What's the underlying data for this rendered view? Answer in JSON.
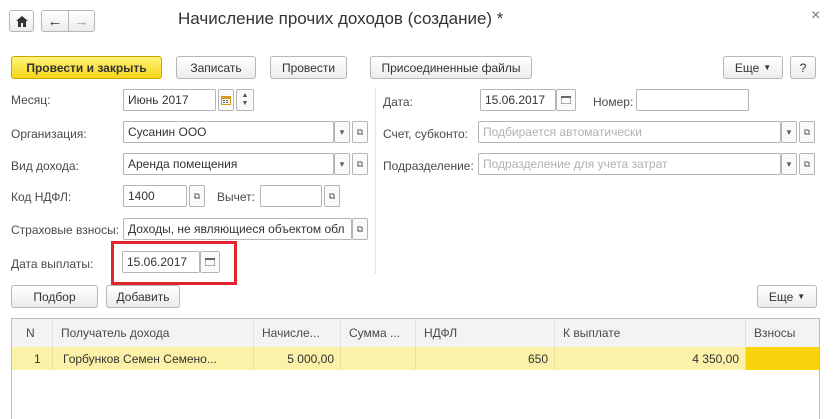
{
  "window": {
    "title": "Начисление прочих доходов (создание) *",
    "close_glyph": "×"
  },
  "nav": {
    "home_glyph": "⌂",
    "back_glyph": "←",
    "forward_glyph": "→"
  },
  "toolbar": {
    "post_and_close": "Провести и закрыть",
    "save": "Записать",
    "post": "Провести",
    "attached_files": "Присоединенные файлы",
    "more": "Еще",
    "help": "?"
  },
  "form": {
    "month": {
      "label": "Месяц:",
      "value": "Июнь 2017"
    },
    "date": {
      "label": "Дата:",
      "value": "15.06.2017"
    },
    "number": {
      "label": "Номер:",
      "value": ""
    },
    "organization": {
      "label": "Организация:",
      "value": "Сусанин ООО"
    },
    "account": {
      "label": "Счет, субконто:",
      "placeholder": "Подбирается автоматически"
    },
    "income_type": {
      "label": "Вид дохода:",
      "value": "Аренда помещения"
    },
    "department": {
      "label": "Подразделение:",
      "placeholder": "Подразделение для учета затрат"
    },
    "ndfl_code": {
      "label": "Код НДФЛ:",
      "value": "1400"
    },
    "deduction": {
      "label": "Вычет:",
      "value": ""
    },
    "insurance": {
      "label": "Страховые взносы:",
      "value": "Доходы, не являющиеся объектом обл"
    },
    "payment_date": {
      "label": "Дата выплаты:",
      "value": "15.06.2017"
    }
  },
  "table_toolbar": {
    "pick": "Подбор",
    "add": "Добавить",
    "more": "Еще"
  },
  "table": {
    "columns": [
      "N",
      "Получатель дохода",
      "Начисле...",
      "Сумма ...",
      "НДФЛ",
      "К выплате",
      "Взносы"
    ],
    "rows": [
      {
        "n": "1",
        "recipient": "Горбунков Семен Семено...",
        "accrued": "5 000,00",
        "sum": "",
        "ndfl": "650",
        "payout": "4 350,00",
        "contrib": ""
      }
    ]
  },
  "colors": {
    "primary_button": "#f7d719",
    "highlight_box": "#e0252d",
    "selected_row": "#fbf1a8",
    "selected_cell": "#f9d30b"
  }
}
